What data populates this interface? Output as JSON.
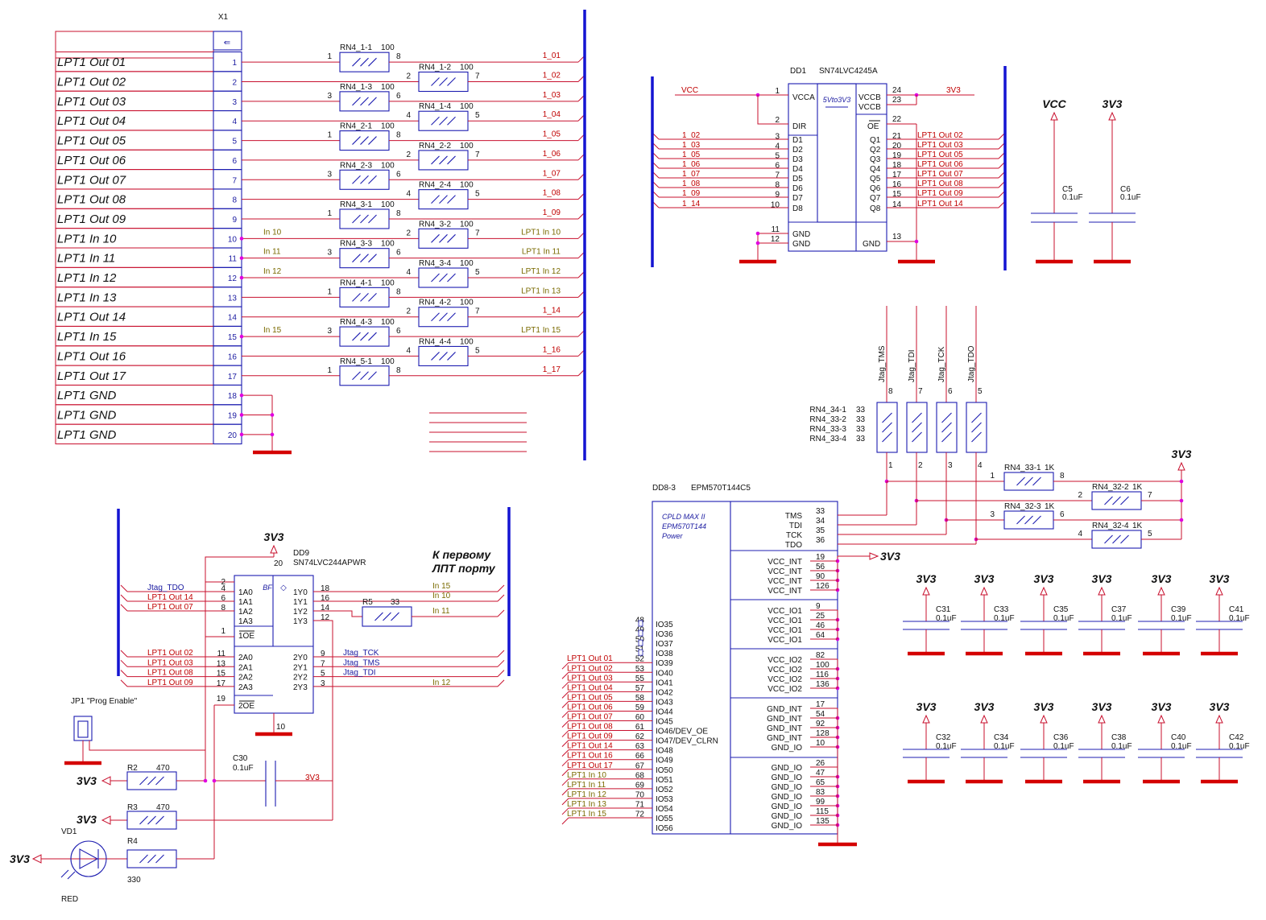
{
  "x1": {
    "ref": "X1",
    "rows": [
      {
        "label": "LPT1 Out 01",
        "pin": "1",
        "res": "RN4_1-1",
        "rv": "100",
        "rp1": "1",
        "rp2": "8",
        "col": 1,
        "net": "1_01",
        "nc": "r"
      },
      {
        "label": "LPT1 Out 02",
        "pin": "2",
        "res": "RN4_1-2",
        "rv": "100",
        "rp1": "2",
        "rp2": "7",
        "col": 2,
        "net": "1_02",
        "nc": "r"
      },
      {
        "label": "LPT1 Out 03",
        "pin": "3",
        "res": "RN4_1-3",
        "rv": "100",
        "rp1": "3",
        "rp2": "6",
        "col": 1,
        "net": "1_03",
        "nc": "r"
      },
      {
        "label": "LPT1 Out 04",
        "pin": "4",
        "res": "RN4_1-4",
        "rv": "100",
        "rp1": "4",
        "rp2": "5",
        "col": 2,
        "net": "1_04",
        "nc": "r"
      },
      {
        "label": "LPT1 Out 05",
        "pin": "5",
        "res": "RN4_2-1",
        "rv": "100",
        "rp1": "1",
        "rp2": "8",
        "col": 1,
        "net": "1_05",
        "nc": "r"
      },
      {
        "label": "LPT1 Out 06",
        "pin": "6",
        "res": "RN4_2-2",
        "rv": "100",
        "rp1": "2",
        "rp2": "7",
        "col": 2,
        "net": "1_06",
        "nc": "r"
      },
      {
        "label": "LPT1 Out 07",
        "pin": "7",
        "res": "RN4_2-3",
        "rv": "100",
        "rp1": "3",
        "rp2": "6",
        "col": 1,
        "net": "1_07",
        "nc": "r"
      },
      {
        "label": "LPT1 Out 08",
        "pin": "8",
        "res": "RN4_2-4",
        "rv": "100",
        "rp1": "4",
        "rp2": "5",
        "col": 2,
        "net": "1_08",
        "nc": "r"
      },
      {
        "label": "LPT1 Out 09",
        "pin": "9",
        "res": "RN4_3-1",
        "rv": "100",
        "rp1": "1",
        "rp2": "8",
        "col": 1,
        "net": "1_09",
        "nc": "r"
      },
      {
        "label": "LPT1 In 10",
        "pin": "10",
        "res": "RN4_3-2",
        "rv": "100",
        "rp1": "2",
        "rp2": "7",
        "col": 2,
        "net": "LPT1 In 10",
        "nc": "g",
        "inl": "In 10"
      },
      {
        "label": "LPT1 In 11",
        "pin": "11",
        "res": "RN4_3-3",
        "rv": "100",
        "rp1": "3",
        "rp2": "6",
        "col": 1,
        "net": "LPT1 In 11",
        "nc": "g",
        "inl": "In 11"
      },
      {
        "label": "LPT1 In 12",
        "pin": "12",
        "res": "RN4_3-4",
        "rv": "100",
        "rp1": "4",
        "rp2": "5",
        "col": 2,
        "net": "LPT1 In 12",
        "nc": "g",
        "inl": "In 12"
      },
      {
        "label": "LPT1 In 13",
        "pin": "13",
        "res": "RN4_4-1",
        "rv": "100",
        "rp1": "1",
        "rp2": "8",
        "col": 1,
        "net": "LPT1 In 13",
        "nc": "g"
      },
      {
        "label": "LPT1 Out 14",
        "pin": "14",
        "res": "RN4_4-2",
        "rv": "100",
        "rp1": "2",
        "rp2": "7",
        "col": 2,
        "net": "1_14",
        "nc": "r"
      },
      {
        "label": "LPT1 In 15",
        "pin": "15",
        "res": "RN4_4-3",
        "rv": "100",
        "rp1": "3",
        "rp2": "6",
        "col": 1,
        "net": "LPT1 In 15",
        "nc": "g",
        "inl": "In 15"
      },
      {
        "label": "LPT1 Out 16",
        "pin": "16",
        "res": "RN4_4-4",
        "rv": "100",
        "rp1": "4",
        "rp2": "5",
        "col": 2,
        "net": "1_16",
        "nc": "r"
      },
      {
        "label": "LPT1 Out 17",
        "pin": "17",
        "res": "RN4_5-1",
        "rv": "100",
        "rp1": "1",
        "rp2": "8",
        "col": 1,
        "net": "1_17",
        "nc": "r"
      },
      {
        "label": "LPT1 GND",
        "pin": "18"
      },
      {
        "label": "LPT1 GND",
        "pin": "19"
      },
      {
        "label": "LPT1 GND",
        "pin": "20"
      }
    ]
  },
  "dd1": {
    "ref": "DD1",
    "part": "SN74LVC4245A",
    "inner": "5Vto3V3",
    "vcc_net": "VCC",
    "v33_net": "3V3",
    "left": [
      {
        "net": "",
        "pin": "1",
        "name": "VCCA"
      },
      {
        "net": "",
        "pin": "2",
        "name": "DIR"
      },
      {
        "net": "1_02",
        "pin": "3",
        "name": "D1"
      },
      {
        "net": "1_03",
        "pin": "4",
        "name": "D2"
      },
      {
        "net": "1_05",
        "pin": "5",
        "name": "D3"
      },
      {
        "net": "1_06",
        "pin": "6",
        "name": "D4"
      },
      {
        "net": "1_07",
        "pin": "7",
        "name": "D5"
      },
      {
        "net": "1_08",
        "pin": "8",
        "name": "D6"
      },
      {
        "net": "1_09",
        "pin": "9",
        "name": "D7"
      },
      {
        "net": "1_14",
        "pin": "10",
        "name": "D8"
      },
      {
        "net": "",
        "pin": "11",
        "name": "GND"
      },
      {
        "net": "",
        "pin": "12",
        "name": "GND"
      }
    ],
    "right": [
      {
        "pin": "24",
        "name": "VCCB",
        "net": ""
      },
      {
        "pin": "23",
        "name": "VCCB",
        "net": ""
      },
      {
        "pin": "22",
        "name": "OE",
        "net": ""
      },
      {
        "pin": "21",
        "name": "Q1",
        "net": "LPT1 Out 02"
      },
      {
        "pin": "20",
        "name": "Q2",
        "net": "LPT1 Out 03"
      },
      {
        "pin": "19",
        "name": "Q3",
        "net": "LPT1 Out 05"
      },
      {
        "pin": "18",
        "name": "Q4",
        "net": "LPT1 Out 06"
      },
      {
        "pin": "17",
        "name": "Q5",
        "net": "LPT1 Out 07"
      },
      {
        "pin": "16",
        "name": "Q6",
        "net": "LPT1 Out 08"
      },
      {
        "pin": "15",
        "name": "Q7",
        "net": "LPT1 Out 09"
      },
      {
        "pin": "14",
        "name": "Q8",
        "net": "LPT1 Out 14"
      },
      {
        "pin": "13",
        "name": "GND",
        "net": ""
      }
    ]
  },
  "caps_top": [
    {
      "power": "VCC",
      "ref": "C5",
      "val": "0.1uF"
    },
    {
      "power": "3V3",
      "ref": "C6",
      "val": "0.1uF"
    }
  ],
  "jtag": {
    "nets": [
      "Jtag_TMS",
      "Jtag_TDI",
      "Jtag_TCK",
      "Jtag_TDO"
    ],
    "top_pins": [
      "8",
      "7",
      "6",
      "5"
    ],
    "bot_pins": [
      "1",
      "2",
      "3",
      "4"
    ],
    "rn_refs": [
      "RN4_34-1",
      "RN4_33-2",
      "RN4_33-3",
      "RN4_33-4"
    ],
    "rn_val": "33",
    "pullups": [
      {
        "ref": "RN4_33-1",
        "val": "1K",
        "p1": "1",
        "p2": "8"
      },
      {
        "ref": "RN4_32-2",
        "val": "1K",
        "p1": "2",
        "p2": "7"
      },
      {
        "ref": "RN4_32-3",
        "val": "1K",
        "p1": "3",
        "p2": "6"
      },
      {
        "ref": "RN4_32-4",
        "val": "1K",
        "p1": "4",
        "p2": "5"
      }
    ],
    "power": "3V3"
  },
  "cpld": {
    "ref": "DD8-3",
    "part": "EPM570T144C5",
    "title": [
      "CPLD MAX II",
      "EPM570T144",
      "Power"
    ],
    "jtag_pins": [
      {
        "n": "TMS",
        "p": "33"
      },
      {
        "n": "TDI",
        "p": "34"
      },
      {
        "n": "TCK",
        "p": "35"
      },
      {
        "n": "TDO",
        "p": "36"
      }
    ],
    "power_net": "3V3",
    "vint": [
      {
        "p": "19",
        "n": "VCC_INT"
      },
      {
        "p": "56",
        "n": "VCC_INT"
      },
      {
        "p": "90",
        "n": "VCC_INT"
      },
      {
        "p": "126",
        "n": "VCC_INT"
      }
    ],
    "vio1": [
      {
        "p": "9",
        "n": "VCC_IO1"
      },
      {
        "p": "25",
        "n": "VCC_IO1"
      },
      {
        "p": "46",
        "n": "VCC_IO1"
      },
      {
        "p": "64",
        "n": "VCC_IO1"
      }
    ],
    "vio2": [
      {
        "p": "82",
        "n": "VCC_IO2"
      },
      {
        "p": "100",
        "n": "VCC_IO2"
      },
      {
        "p": "116",
        "n": "VCC_IO2"
      },
      {
        "p": "136",
        "n": "VCC_IO2"
      }
    ],
    "gint": [
      {
        "p": "17",
        "n": "GND_INT"
      },
      {
        "p": "54",
        "n": "GND_INT"
      },
      {
        "p": "92",
        "n": "GND_INT"
      },
      {
        "p": "128",
        "n": "GND_INT"
      },
      {
        "p": "10",
        "n": "GND_IO"
      }
    ],
    "gio": [
      {
        "p": "26",
        "n": "GND_IO"
      },
      {
        "p": "47",
        "n": "GND_IO"
      },
      {
        "p": "65",
        "n": "GND_IO"
      },
      {
        "p": "83",
        "n": "GND_IO"
      },
      {
        "p": "99",
        "n": "GND_IO"
      },
      {
        "p": "115",
        "n": "GND_IO"
      },
      {
        "p": "135",
        "n": "GND_IO"
      }
    ],
    "io": [
      {
        "n": "IO35",
        "p": "48",
        "net": "",
        "c": ""
      },
      {
        "n": "IO36",
        "p": "49",
        "net": "",
        "c": ""
      },
      {
        "n": "IO37",
        "p": "50",
        "net": "",
        "c": ""
      },
      {
        "n": "IO38",
        "p": "51",
        "net": "",
        "c": ""
      },
      {
        "n": "IO39",
        "p": "52",
        "net": "LPT1 Out 01",
        "c": "r"
      },
      {
        "n": "IO40",
        "p": "53",
        "net": "LPT1 Out 02",
        "c": "r"
      },
      {
        "n": "IO41",
        "p": "55",
        "net": "LPT1 Out 03",
        "c": "r"
      },
      {
        "n": "IO42",
        "p": "57",
        "net": "LPT1 Out 04",
        "c": "r"
      },
      {
        "n": "IO43",
        "p": "58",
        "net": "LPT1 Out 05",
        "c": "r"
      },
      {
        "n": "IO44",
        "p": "59",
        "net": "LPT1 Out 06",
        "c": "r"
      },
      {
        "n": "IO45",
        "p": "60",
        "net": "LPT1 Out 07",
        "c": "r"
      },
      {
        "n": "IO46/DEV_OE",
        "p": "61",
        "net": "LPT1 Out 08",
        "c": "r"
      },
      {
        "n": "IO47/DEV_CLRN",
        "p": "62",
        "net": "LPT1 Out 09",
        "c": "r"
      },
      {
        "n": "IO48",
        "p": "63",
        "net": "LPT1 Out 14",
        "c": "r"
      },
      {
        "n": "IO49",
        "p": "66",
        "net": "LPT1 Out 16",
        "c": "r"
      },
      {
        "n": "IO50",
        "p": "67",
        "net": "LPT1 Out 17",
        "c": "r"
      },
      {
        "n": "IO51",
        "p": "68",
        "net": "LPT1 In 10",
        "c": "g"
      },
      {
        "n": "IO52",
        "p": "69",
        "net": "LPT1 In 11",
        "c": "g"
      },
      {
        "n": "IO53",
        "p": "70",
        "net": "LPT1 In 12",
        "c": "g"
      },
      {
        "n": "IO54",
        "p": "71",
        "net": "LPT1 In 13",
        "c": "g"
      },
      {
        "n": "IO55",
        "p": "72",
        "net": "LPT1 In 15",
        "c": "g"
      },
      {
        "n": "IO56",
        "p": "",
        "net": "",
        "c": ""
      }
    ]
  },
  "dd9": {
    "ref": "DD9",
    "part": "SN74LVC244APWR",
    "power": "3V3",
    "vcc_pin": "20",
    "gnd_pin": "10",
    "note": [
      "К первому",
      "ЛПТ порту"
    ],
    "g1": [
      {
        "net": "Jtag_TDO",
        "c": "b",
        "p": "4",
        "a": "1A0",
        "y": "1Y0",
        "yp": "18",
        "o": "In 15",
        "oc": "g"
      },
      {
        "net": "LPT1 Out 14",
        "c": "r",
        "p": "6",
        "a": "1A1",
        "y": "1Y1",
        "yp": "16",
        "o": "In 10",
        "oc": "g"
      },
      {
        "net": "LPT1 Out 07",
        "c": "r",
        "p": "8",
        "a": "1A2",
        "y": "1Y2",
        "yp": "14",
        "o": "In 11",
        "oc": "g"
      },
      {
        "net": "",
        "c": "",
        "p": "",
        "a": "1A3",
        "y": "1Y3",
        "yp": "12",
        "o": "",
        "oc": ""
      }
    ],
    "g2": [
      {
        "net": "LPT1 Out 02",
        "c": "r",
        "p": "11",
        "a": "2A0",
        "y": "2Y0",
        "yp": "9",
        "o": "Jtag_TCK",
        "oc": "b"
      },
      {
        "net": "LPT1 Out 03",
        "c": "r",
        "p": "13",
        "a": "2A1",
        "y": "2Y1",
        "yp": "7",
        "o": "Jtag_TMS",
        "oc": "b"
      },
      {
        "net": "LPT1 Out 08",
        "c": "r",
        "p": "15",
        "a": "2A2",
        "y": "2Y2",
        "yp": "5",
        "o": "Jtag_TDI",
        "oc": "b"
      },
      {
        "net": "LPT1 Out 09",
        "c": "r",
        "p": "17",
        "a": "2A3",
        "y": "2Y3",
        "yp": "3",
        "o": "In 12",
        "oc": "g"
      }
    ],
    "pin2": "2",
    "pin1": "1",
    "oe1": "1OE",
    "pin19": "19",
    "oe2": "2OE",
    "r5": {
      "ref": "R5",
      "val": "33"
    }
  },
  "misc": {
    "jp1": "JP1 \"Prog Enable\"",
    "r2": {
      "ref": "R2",
      "val": "470"
    },
    "r3": {
      "ref": "R3",
      "val": "470"
    },
    "r4": {
      "ref": "R4",
      "val": "330"
    },
    "c30": {
      "ref": "C30",
      "val": "0.1uF",
      "net": "3V3"
    },
    "vd1": {
      "ref": "VD1",
      "color": "RED"
    },
    "power": "3V3"
  },
  "caps_bottom": [
    {
      "ref": "C31",
      "val": "0.1uF"
    },
    {
      "ref": "C33",
      "val": "0.1uF"
    },
    {
      "ref": "C35",
      "val": "0.1uF"
    },
    {
      "ref": "C37",
      "val": "0.1uF"
    },
    {
      "ref": "C39",
      "val": "0.1uF"
    },
    {
      "ref": "C41",
      "val": "0.1uF"
    },
    {
      "ref": "C32",
      "val": "0.1uF"
    },
    {
      "ref": "C34",
      "val": "0.1uF"
    },
    {
      "ref": "C36",
      "val": "0.1uF"
    },
    {
      "ref": "C38",
      "val": "0.1uF"
    },
    {
      "ref": "C40",
      "val": "0.1uF"
    },
    {
      "ref": "C42",
      "val": "0.1uF"
    }
  ],
  "caps_bottom_power": "3V3"
}
